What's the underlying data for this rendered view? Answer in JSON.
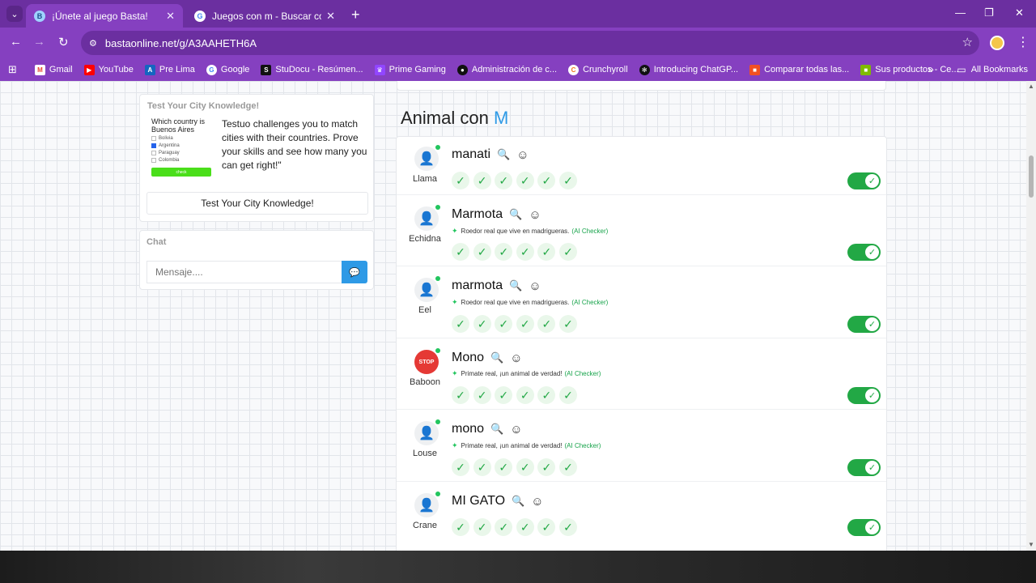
{
  "browser": {
    "tabs": [
      {
        "title": "¡Únete al juego Basta!",
        "active": true
      },
      {
        "title": "Juegos con m - Buscar con Goo",
        "active": false
      }
    ],
    "url": "bastaonline.net/g/A3AAHETH6A",
    "bookmarks": [
      "Gmail",
      "YouTube",
      "Pre Lima",
      "Google",
      "StuDocu - Resúmen...",
      "Prime Gaming",
      "Administración de c...",
      "Crunchyroll",
      "Introducing ChatGP...",
      "Comparar todas las...",
      "Sus productos - Ce..."
    ],
    "all_bookmarks": "All Bookmarks"
  },
  "promo": {
    "header": "Test Your City Knowledge!",
    "quiz_question": "Which country is Buenos Aires",
    "quiz_options": [
      "Bolivia",
      "Argentina",
      "Paraguay",
      "Colombia"
    ],
    "quiz_button": "check",
    "text": "Testuo challenges you to match cities with their countries. Prove your skills and see how many you can get right!\"",
    "button": "Test Your City Knowledge!"
  },
  "chat": {
    "header": "Chat",
    "placeholder": "Mensaje...."
  },
  "category": {
    "prefix": "Animal con",
    "letter": "M"
  },
  "answers": [
    {
      "player": "Llama",
      "word": "manati",
      "hint": "",
      "checker": "",
      "stop": false
    },
    {
      "player": "Echidna",
      "word": "Marmota",
      "hint": "Roedor real que vive en madrigueras.",
      "checker": "(AI Checker)",
      "stop": false
    },
    {
      "player": "Eel",
      "word": "marmota",
      "hint": "Roedor real que vive en madrigueras.",
      "checker": "(AI Checker)",
      "stop": false
    },
    {
      "player": "Baboon",
      "word": "Mono",
      "hint": "Primate real, ¡un animal de verdad!",
      "checker": "(AI Checker)",
      "stop": true
    },
    {
      "player": "Louse",
      "word": "mono",
      "hint": "Primate real, ¡un animal de verdad!",
      "checker": "(AI Checker)",
      "stop": false
    },
    {
      "player": "Crane",
      "word": "MI GATO",
      "hint": "",
      "checker": "",
      "stop": false
    }
  ],
  "stop_badge": "STOP",
  "colors": {
    "accent": "#2e9ae6",
    "success": "#22a845",
    "browser": "#8540c0"
  }
}
